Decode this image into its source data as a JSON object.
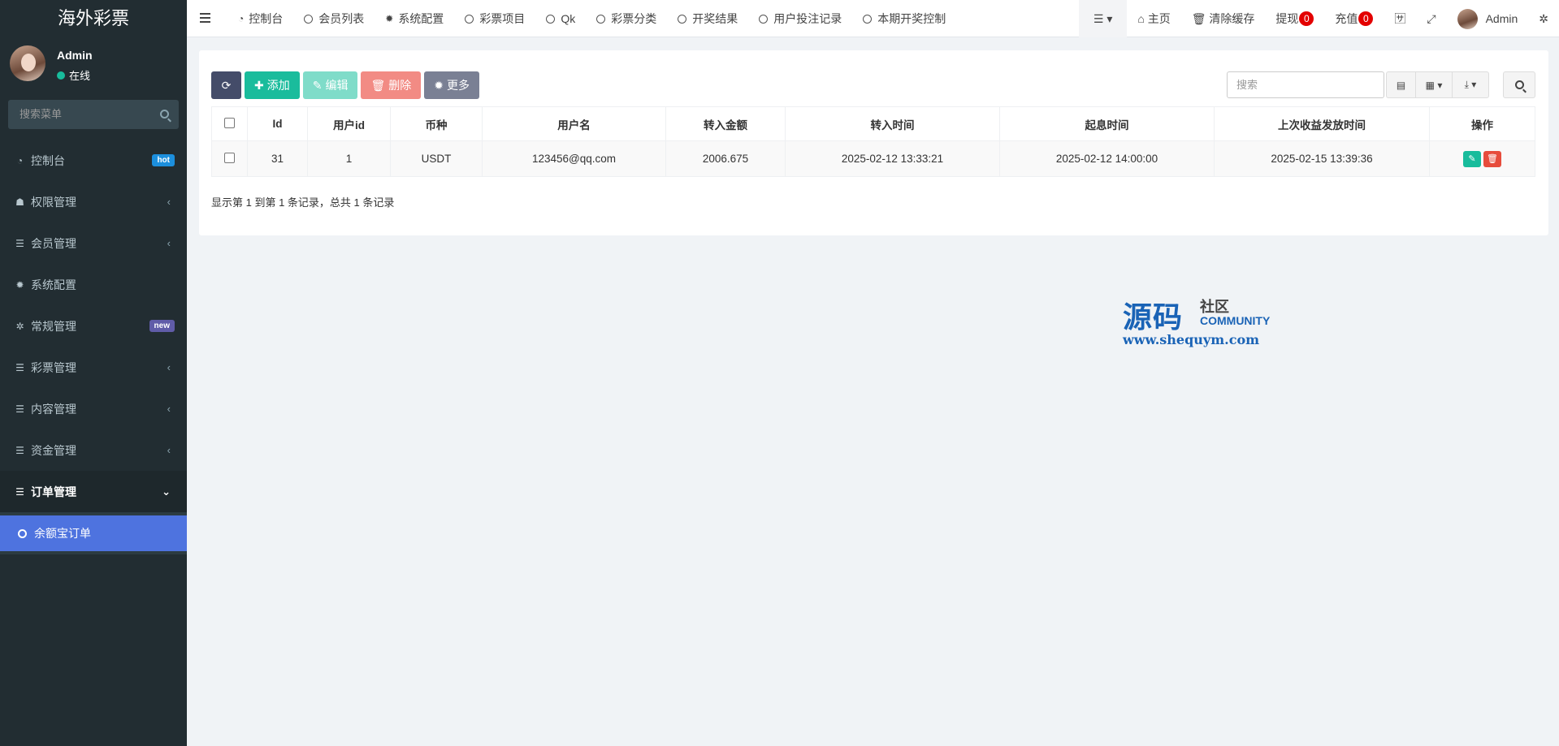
{
  "app": {
    "title": "海外彩票"
  },
  "user": {
    "name": "Admin",
    "status": "在线"
  },
  "sidebar": {
    "search_placeholder": "搜索菜单",
    "items": [
      {
        "label": "控制台",
        "icon": "dashboard-icon",
        "badge": "hot"
      },
      {
        "label": "权限管理",
        "icon": "users-icon"
      },
      {
        "label": "会员管理",
        "icon": "list-icon"
      },
      {
        "label": "系统配置",
        "icon": "gear-icon"
      },
      {
        "label": "常规管理",
        "icon": "gears-icon",
        "badge": "new"
      },
      {
        "label": "彩票管理",
        "icon": "list-icon"
      },
      {
        "label": "内容管理",
        "icon": "list-icon"
      },
      {
        "label": "资金管理",
        "icon": "list-icon"
      },
      {
        "label": "订单管理",
        "icon": "list-icon"
      }
    ],
    "subitem": "余额宝订单"
  },
  "topbar": {
    "tabs": [
      "控制台",
      "会员列表",
      "系统配置",
      "彩票项目",
      "Qk",
      "彩票分类",
      "开奖结果",
      "用户投注记录",
      "本期开奖控制"
    ],
    "home": "主页",
    "clear_cache": "清除缓存",
    "withdraw": "提现",
    "withdraw_count": "0",
    "recharge": "充值",
    "recharge_count": "0",
    "admin": "Admin"
  },
  "toolbar": {
    "add": "添加",
    "edit": "编辑",
    "delete": "删除",
    "more": "更多",
    "search_placeholder": "搜索"
  },
  "table": {
    "headers": [
      "Id",
      "用户id",
      "币种",
      "用户名",
      "转入金额",
      "转入时间",
      "起息时间",
      "上次收益发放时间",
      "操作"
    ],
    "rows": [
      [
        "31",
        "1",
        "USDT",
        "123456@qq.com",
        "2006.675",
        "2025-02-12 13:33:21",
        "2025-02-12 14:00:00",
        "2025-02-15 13:39:36"
      ]
    ]
  },
  "pagination": {
    "info": "显示第 1 到第 1 条记录，总共 1 条记录"
  },
  "watermark": {
    "brand": "源码",
    "small": "社区",
    "community": "COMMUNITY",
    "url": "www.shequym.com"
  },
  "colors": {
    "sidebar": "#222d32",
    "accent": "#4e73df",
    "success": "#1abc9c",
    "danger": "#e74c3c"
  }
}
